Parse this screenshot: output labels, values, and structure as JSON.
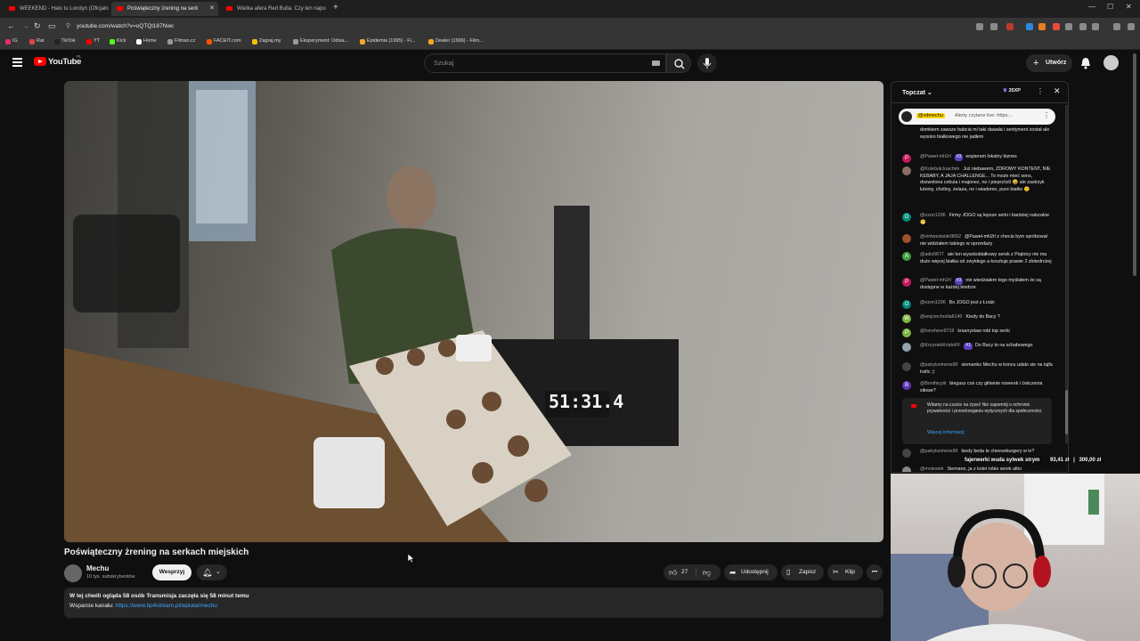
{
  "browser": {
    "tabs": [
      {
        "title": "WEEKEND - Halo tu Londyn (Oficjaln",
        "active": false
      },
      {
        "title": "Poświąteczny żrening na serk",
        "active": true
      },
      {
        "title": "Wielka afera Red Bulla. Czy ten napo",
        "active": false
      }
    ],
    "new_tab": "+",
    "url": "youtube.com/watch?v=oQTQl187Nwc",
    "bookmarks": [
      {
        "label": "IG",
        "color": "#e1306c"
      },
      {
        "label": "Rat",
        "color": "#d44"
      },
      {
        "label": "YT",
        "color": "#f00"
      },
      {
        "label": "TikTok",
        "color": "#222"
      },
      {
        "label": "Kick",
        "color": "#53fc18"
      },
      {
        "label": "Home",
        "color": "#fff"
      },
      {
        "label": "Filman.cc",
        "color": "#999"
      },
      {
        "label": "FACEIT.com",
        "color": "#ff5500"
      },
      {
        "label": "Zagraj.my",
        "color": "#f0c000"
      },
      {
        "label": "Eksperyment: Odsia...",
        "color": "#999"
      },
      {
        "label": "Epidemia (1995) - Fi...",
        "color": "#f5a623"
      },
      {
        "label": "Dealer (1996) - Film...",
        "color": "#f5a623"
      }
    ]
  },
  "youtube": {
    "logo_text": "YouTube",
    "region": "PL",
    "search_placeholder": "Szukaj",
    "create_label": "Utwórz"
  },
  "video": {
    "timer_text": "51:31.4",
    "title": "Poświąteczny żrening na serkach miejskich",
    "channel": {
      "name": "Mechu",
      "subscribers": "10 tys. subskrybentów"
    },
    "support_label": "Wesprzyj",
    "likes": "27",
    "share_label": "Udostępnij",
    "save_label": "Zapisz",
    "clip_label": "Klip",
    "description": {
      "line1": "W tej chwili ogląda 58 osób  Transmisja zaczęła się 58 minut temu",
      "line2_prefix": "Wsparcie kanału: ",
      "line2_link": "https://www.tip4stream.pl/wplata/mechu"
    }
  },
  "chat": {
    "mode": "Topczat",
    "xp_badge": "25XP",
    "pinned": {
      "author": "@xdmechu",
      "text": "Alerty czytane live: https:..."
    },
    "messages": [
      {
        "author": "",
        "badge": "",
        "text": "domkiem zawsze babcia mi taki dawała i sentyment został ale wysoko białkowego nie jadłem",
        "avatar_letter": "",
        "avatar_color": "#555"
      },
      {
        "author": "@Paweł-mh2rl",
        "badge": "#3",
        "text": "wspieram lokalny biznes",
        "avatar_letter": "P",
        "avatar_color": "#c2185b"
      },
      {
        "author": "@KolebukJoachim",
        "badge": "",
        "text": "Już niebawem, ZDROWY KONTENT, NIE KEBABY, A JAJA CHALLENGE... To może mieć sens, dozwolona cebula i majonez, no i pieprz/sól 😄 ale zastrzyk luteiny, choliny, żelaza, no i wiadomo, pure białko 🙂",
        "avatar_letter": "",
        "avatar_color": "#8d6e63"
      },
      {
        "author": "@ozon1296",
        "badge": "",
        "text": "Firmy JOGO są lepsze serki i bardziej naturalne 😬",
        "avatar_letter": "O",
        "avatar_color": "#00897b"
      },
      {
        "author": "@vintwestside9652",
        "badge": "",
        "text": "@Paweł-mh2rl z checia bym spróbował nie widziałem takiego w sprzedaży",
        "avatar_letter": "",
        "avatar_color": "#a0522d"
      },
      {
        "author": "@adis5677",
        "badge": "",
        "text": "ale ten wysokobiałkowy serek z Piątnicy nie ma dużo więcej białka od zwykłego a kosztuje prawie 2 złotedrożej",
        "avatar_letter": "A",
        "avatar_color": "#43a047"
      },
      {
        "author": "@Paweł-mh2rl",
        "badge": "#3",
        "text": "nie wiedziałem tego myślałem że są dostępne w każdej biedrze",
        "avatar_letter": "P",
        "avatar_color": "#c2185b"
      },
      {
        "author": "@ozon1296",
        "badge": "",
        "text": "Bo JOGO jest z Łodzi",
        "avatar_letter": "O",
        "avatar_color": "#00897b"
      },
      {
        "author": "@wojciechrolla6140",
        "badge": "",
        "text": "Kiedy do Bacy ?",
        "avatar_letter": "W",
        "avatar_color": "#7cb342"
      },
      {
        "author": "@herehere9718",
        "badge": "",
        "text": "krasnystaw robi top serki",
        "avatar_letter": "P",
        "avatar_color": "#7cb342"
      },
      {
        "author": "@KrzysiekKristoFF",
        "badge": "#1",
        "text": "Do Bacy to na schabowego",
        "avatar_letter": "",
        "avatar_color": "#90a4ae"
      },
      {
        "author": "@patryksimens90",
        "badge": "",
        "text": "siemanko Mechu w koncu udalo sie na lajfa trafic ;)",
        "avatar_letter": "",
        "avatar_color": "#444"
      },
      {
        "author": "@Bonifacyiii",
        "badge": "",
        "text": "biegasz coś czy głównie rowerek i ćwiczenia siłowe?",
        "avatar_letter": "B",
        "avatar_color": "#5e35b1"
      }
    ],
    "notice": {
      "text": "Witamy na czacie na żywo! Nie zapomnij o ochronie prywatności i przestrzeganiu wytycznych dla społeczności.",
      "link": "Więcej informacji"
    },
    "after_notice": [
      {
        "author": "@patryksimens90",
        "badge": "",
        "text": "kiedy beda te cheeseburgery w tv?",
        "avatar_letter": "",
        "avatar_color": "#444"
      },
      {
        "author": "@molestek",
        "badge": "",
        "text": "Siemano, ja z kolei robie serek albo",
        "avatar_letter": "",
        "avatar_color": "#888"
      }
    ]
  },
  "stream_overlay": {
    "text": "fajerwerki wuda sylwek strym",
    "amount1": "93,41 zł",
    "amount2": "300,00 zł"
  }
}
